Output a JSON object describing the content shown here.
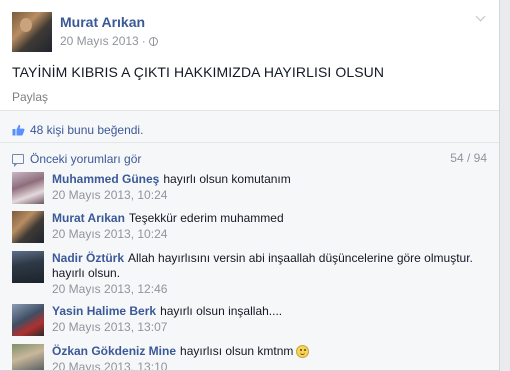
{
  "post": {
    "author": "Murat Arıkan",
    "date": "20 Mayıs 2013",
    "separator": "·",
    "text": "TAYİNİM KIBRIS A ÇIKTI HAKKIMIZDA HAYIRLISI OLSUN",
    "share_label": "Paylaş",
    "icons": {
      "privacy": "globe-icon",
      "menu": "chevron-down-icon"
    }
  },
  "ufi": {
    "likes_text": "48 kişi bunu beğendi.",
    "previous_comments_label": "Önceki yorumları gör",
    "comment_count": "54 / 94"
  },
  "comments": [
    {
      "name": "Muhammed Güneş",
      "text": "hayırlı olsun komutanım",
      "time": "20 Mayıs 2013, 10:24"
    },
    {
      "name": "Murat Arıkan",
      "text": "Teşekkür ederim muhammed",
      "time": "20 Mayıs 2013, 10:24"
    },
    {
      "name": "Nadir Öztürk",
      "text": "Allah hayırlısını versin abi inşaallah düşüncelerine göre olmuştur. hayırlı olsun.",
      "time": "20 Mayıs 2013, 12:46"
    },
    {
      "name": "Yasin Halime Berk",
      "text": "hayırlı olsun inşallah....",
      "time": "20 Mayıs 2013, 13:07"
    },
    {
      "name": "Özkan Gökdeniz Mine",
      "text": "hayırlısı olsun kmtnm",
      "time": "20 Mayıs 2013, 13:10"
    }
  ],
  "colors": {
    "link": "#3b5998",
    "muted": "#90949c",
    "ufi_background": "#f6f7f9"
  }
}
